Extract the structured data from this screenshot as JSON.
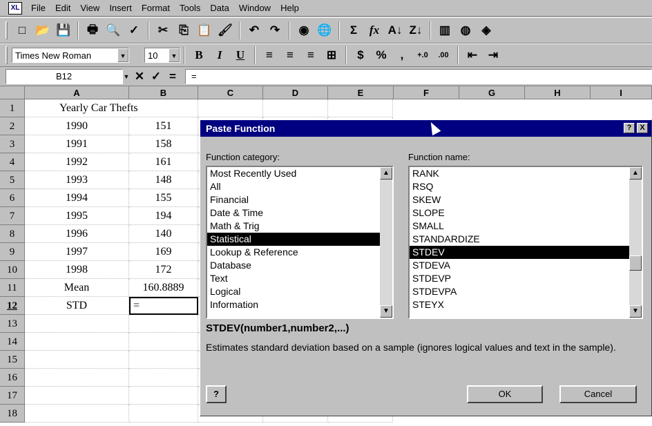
{
  "app": {
    "icon_text": "XL"
  },
  "menu": [
    "File",
    "Edit",
    "View",
    "Insert",
    "Format",
    "Tools",
    "Data",
    "Window",
    "Help"
  ],
  "toolbar1": {
    "buttons": [
      "new-icon",
      "open-icon",
      "save-icon",
      "print-icon",
      "print-preview-icon",
      "spelling-icon",
      "cut-icon",
      "copy-icon",
      "paste-icon",
      "format-painter-icon",
      "undo-icon",
      "redo-icon",
      "web-icon",
      "hyperlink-icon",
      "autosum-icon",
      "paste-function-icon",
      "sort-ascending-icon",
      "sort-descending-icon",
      "chart-wizard-icon",
      "map-icon",
      "drawing-icon"
    ],
    "glyphs": [
      "□",
      "📂",
      "💾",
      "🖶",
      "🔍",
      "✓",
      "✂",
      "⎘",
      "📋",
      "🖌",
      "↶",
      "↷",
      "◉",
      "🌐",
      "Σ",
      "fx",
      "A↓",
      "Z↓",
      "▥",
      "◍",
      "◈"
    ],
    "autosum_label": "Σ",
    "function_label": "fx"
  },
  "toolbar2": {
    "font": "Times New Roman",
    "size": "10",
    "bold": "B",
    "italic": "I",
    "underline": "U",
    "currency": "$",
    "percent": "%",
    "comma": ",",
    "inc_decimal": "+.0",
    "dec_decimal": ".00",
    "align_left": "≡",
    "center": "≡",
    "align_right": "≡",
    "merge": "⊞",
    "indent_dec": "⇤",
    "indent_inc": "⇥"
  },
  "formula_bar": {
    "name_box": "B12",
    "cancel": "✕",
    "enter": "✓",
    "equals": "=",
    "content": "="
  },
  "columns": [
    "A",
    "B",
    "C",
    "D",
    "E",
    "F",
    "G",
    "H",
    "I"
  ],
  "rows": [
    {
      "num": "1",
      "a": "Yearly Car Thefts",
      "b": ""
    },
    {
      "num": "2",
      "a": "1990",
      "b": "151"
    },
    {
      "num": "3",
      "a": "1991",
      "b": "158"
    },
    {
      "num": "4",
      "a": "1992",
      "b": "161"
    },
    {
      "num": "5",
      "a": "1993",
      "b": "148"
    },
    {
      "num": "6",
      "a": "1994",
      "b": "155"
    },
    {
      "num": "7",
      "a": "1995",
      "b": "194"
    },
    {
      "num": "8",
      "a": "1996",
      "b": "140"
    },
    {
      "num": "9",
      "a": "1997",
      "b": "169"
    },
    {
      "num": "10",
      "a": "1998",
      "b": "172"
    },
    {
      "num": "11",
      "a": "Mean",
      "b": "160.8889"
    },
    {
      "num": "12",
      "a": "STD",
      "b": "="
    },
    {
      "num": "13",
      "a": "",
      "b": ""
    },
    {
      "num": "14",
      "a": "",
      "b": ""
    },
    {
      "num": "15",
      "a": "",
      "b": ""
    },
    {
      "num": "16",
      "a": "",
      "b": ""
    },
    {
      "num": "17",
      "a": "",
      "b": ""
    },
    {
      "num": "18",
      "a": "",
      "b": ""
    }
  ],
  "dialog": {
    "title": "Paste Function",
    "help_btn": "?",
    "close_btn": "X",
    "category_label": "Function category:",
    "categories": [
      "Most Recently Used",
      "All",
      "Financial",
      "Date & Time",
      "Math & Trig",
      "Statistical",
      "Lookup & Reference",
      "Database",
      "Text",
      "Logical",
      "Information"
    ],
    "selected_category": "Statistical",
    "name_label": "Function name:",
    "functions": [
      "RANK",
      "RSQ",
      "SKEW",
      "SLOPE",
      "SMALL",
      "STANDARDIZE",
      "STDEV",
      "STDEVA",
      "STDEVP",
      "STDEVPA",
      "STEYX"
    ],
    "selected_function": "STDEV",
    "syntax": "STDEV(number1,number2,...)",
    "description": "Estimates standard deviation based on a sample (ignores logical values and text in the sample).",
    "office_assistant": "?",
    "ok": "OK",
    "cancel": "Cancel"
  }
}
